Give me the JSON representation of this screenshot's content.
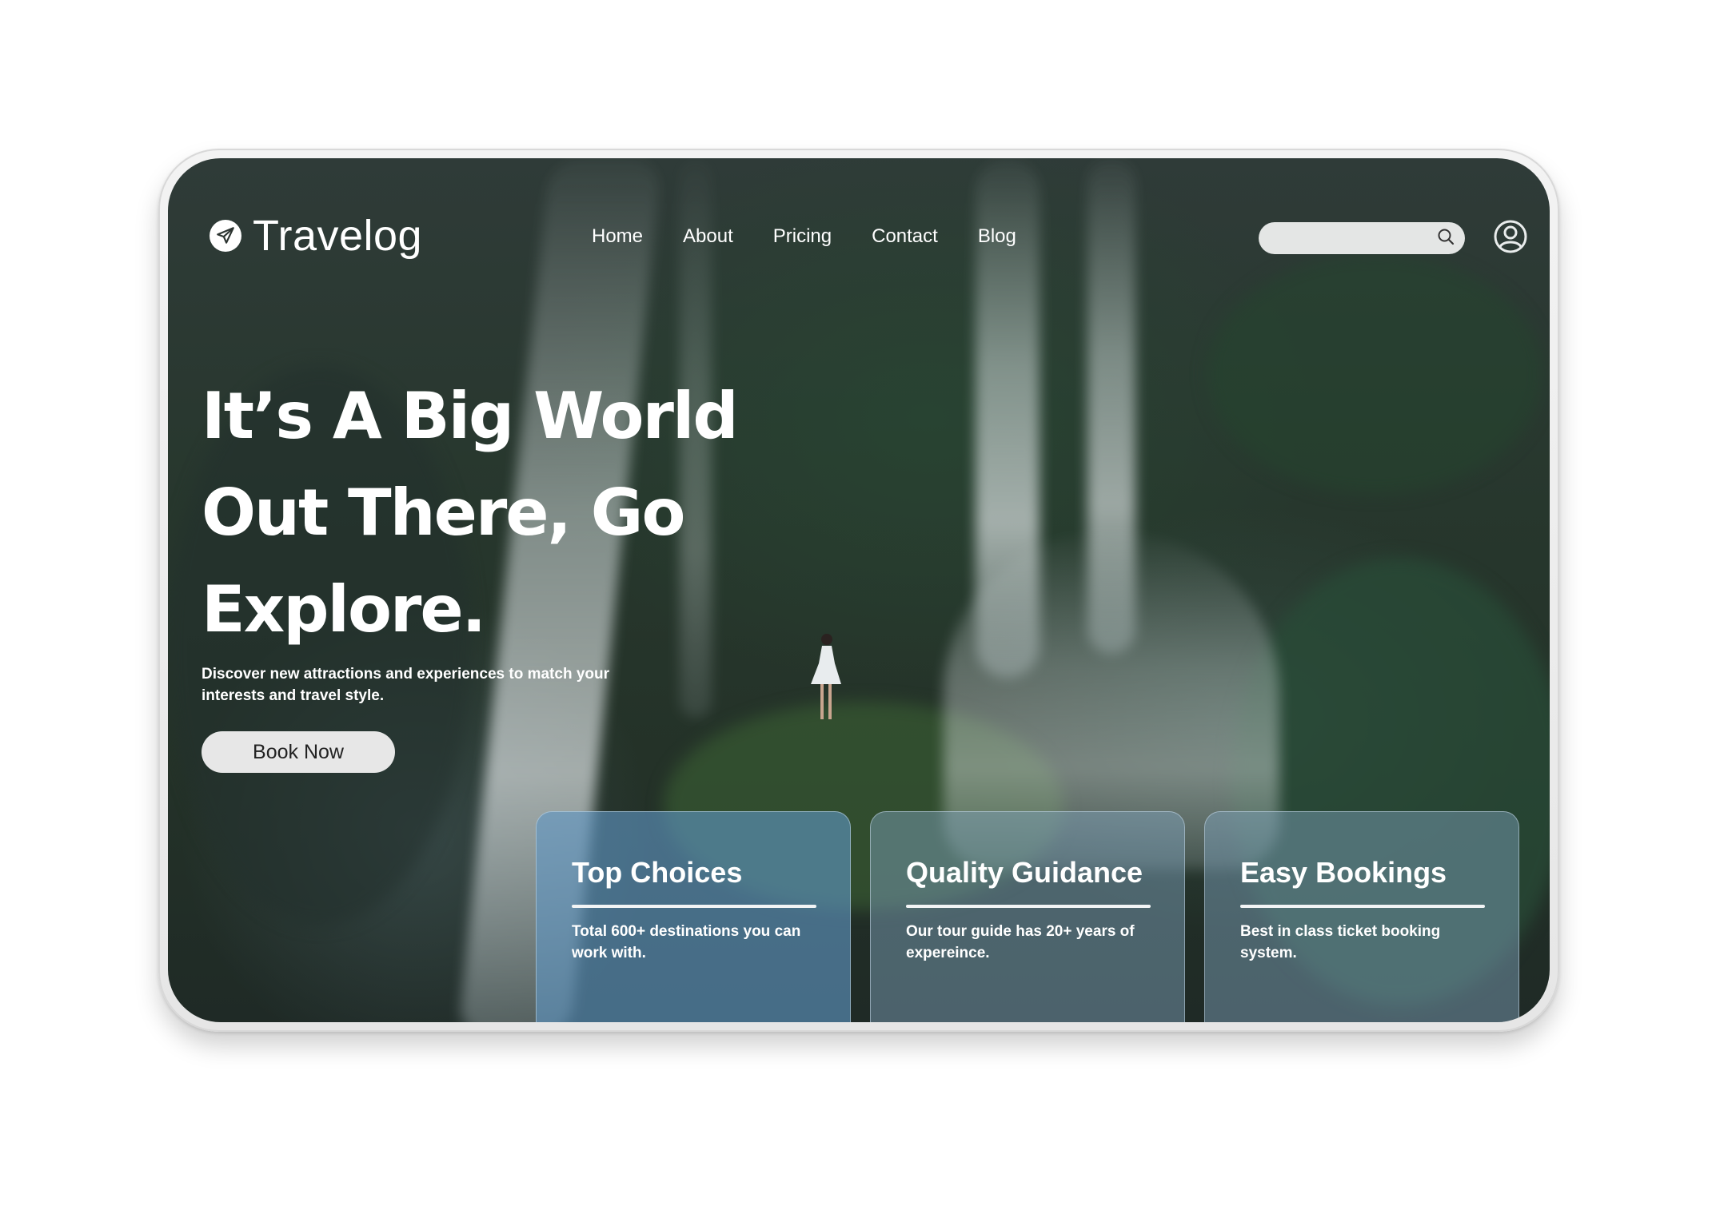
{
  "brand": {
    "name": "Travelog",
    "icon": "paper-plane-icon"
  },
  "nav": {
    "items": [
      {
        "label": "Home"
      },
      {
        "label": "About"
      },
      {
        "label": "Pricing"
      },
      {
        "label": "Contact"
      },
      {
        "label": "Blog"
      }
    ]
  },
  "search": {
    "value": "",
    "placeholder": "",
    "icon": "search-icon"
  },
  "account": {
    "icon": "user-circle-icon"
  },
  "hero": {
    "headline_lines": [
      "It’s A Big World",
      "Out There, Go",
      "Explore."
    ],
    "subtitle": "Discover new attractions and experiences to match your interests and travel style.",
    "cta_label": "Book Now"
  },
  "features": [
    {
      "title": "Top Choices",
      "description": "Total 600+ destinations you can work with."
    },
    {
      "title": "Quality Guidance",
      "description": "Our tour guide has 20+ years of expereince."
    },
    {
      "title": "Easy Bookings",
      "description": "Best in class ticket booking system."
    }
  ],
  "colors": {
    "text": "#ffffff",
    "button_bg": "#e7e7e7",
    "button_text": "#222222",
    "search_bg": "#e4e6e5",
    "card_accent": "#5f96c3"
  }
}
